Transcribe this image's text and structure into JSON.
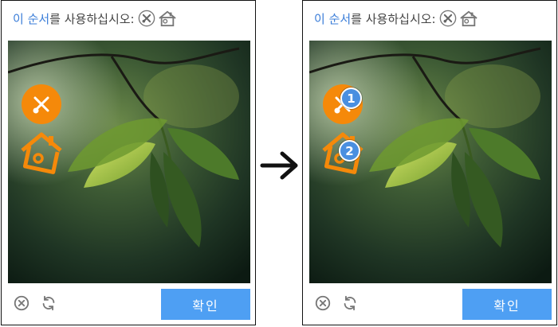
{
  "captcha": {
    "prompt_highlight": "이 순서",
    "prompt_rest": "를 사용하십시오:",
    "prompt_icons": [
      "scissors-icon",
      "house-icon"
    ],
    "confirm_label": "확인",
    "close_icon": "close-circle-icon",
    "refresh_icon": "refresh-icon"
  },
  "overlay_icons": [
    "scissors-icon",
    "house-icon"
  ],
  "order_badges": [
    "1",
    "2"
  ],
  "colors": {
    "accent_blue": "#4e9ff3",
    "highlight_text": "#3a7dd8",
    "overlay_orange": "#f5890a",
    "badge_blue": "#4a8fe0"
  }
}
